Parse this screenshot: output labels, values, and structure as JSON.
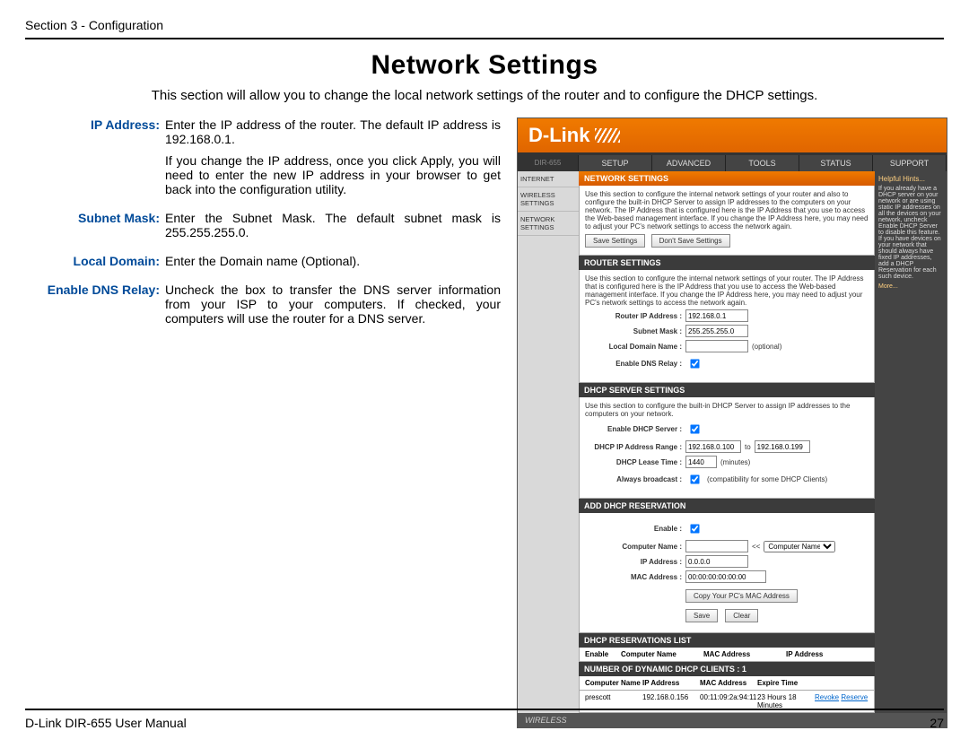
{
  "header": {
    "text": "Section 3 - Configuration"
  },
  "title": "Network Settings",
  "intro": "This section will allow you to change the local network settings of the router and to configure the DHCP settings.",
  "defs": {
    "ip_addr": {
      "term": "IP Address:",
      "p1": "Enter the IP address of the router. The default IP address is 192.168.0.1.",
      "p2": "If you change the IP address, once you click Apply, you will need to enter the new IP address in your browser to get back into the configuration utility."
    },
    "subnet": {
      "term": "Subnet Mask:",
      "p1": "Enter the Subnet Mask. The default subnet mask is 255.255.255.0."
    },
    "domain": {
      "term": "Local Domain:",
      "p1": "Enter the Domain name (Optional)."
    },
    "dnsrelay": {
      "term": "Enable DNS Relay:",
      "p1": "Uncheck the box to transfer the DNS server information from your ISP to your computers. If checked, your computers will use the router for a DNS server."
    }
  },
  "screenshot": {
    "brand": "D-Link",
    "model": "DIR-655",
    "tabs": [
      "SETUP",
      "ADVANCED",
      "TOOLS",
      "STATUS",
      "SUPPORT"
    ],
    "sidebar": [
      "INTERNET",
      "WIRELESS SETTINGS",
      "NETWORK SETTINGS"
    ],
    "support": {
      "title": "Helpful Hints...",
      "body": "If you already have a DHCP server on your network or are using static IP addresses on all the devices on your network, uncheck Enable DHCP Server to disable this feature. If you have devices on your network that should always have fixed IP addresses, add a DHCP Reservation for each such device.",
      "more": "More..."
    },
    "net_panel": {
      "title": "NETWORK SETTINGS",
      "desc": "Use this section to configure the internal network settings of your router and also to configure the built-in DHCP Server to assign IP addresses to the computers on your network. The IP Address that is configured here is the IP Address that you use to access the Web-based management interface. If you change the IP Address here, you may need to adjust your PC's network settings to access the network again.",
      "save": "Save Settings",
      "dont": "Don't Save Settings"
    },
    "router": {
      "title": "ROUTER SETTINGS",
      "desc": "Use this section to configure the internal network settings of your router. The IP Address that is configured here is the IP Address that you use to access the Web-based management interface. If you change the IP Address here, you may need to adjust your PC's network settings to access the network again.",
      "ip_lbl": "Router IP Address :",
      "ip_val": "192.168.0.1",
      "mask_lbl": "Subnet Mask :",
      "mask_val": "255.255.255.0",
      "dom_lbl": "Local Domain Name :",
      "dom_hint": "(optional)",
      "dns_lbl": "Enable DNS Relay :"
    },
    "dhcp": {
      "title": "DHCP SERVER SETTINGS",
      "desc": "Use this section to configure the built-in DHCP Server to assign IP addresses to the computers on your network.",
      "en_lbl": "Enable DHCP Server :",
      "range_lbl": "DHCP IP Address Range :",
      "range_from": "192.168.0.100",
      "range_to_word": "to",
      "range_to": "192.168.0.199",
      "lease_lbl": "DHCP Lease Time :",
      "lease_val": "1440",
      "lease_unit": "(minutes)",
      "bcast_lbl": "Always broadcast :",
      "bcast_hint": "(compatibility for some DHCP Clients)"
    },
    "addres": {
      "title": "ADD DHCP RESERVATION",
      "en_lbl": "Enable :",
      "cn_lbl": "Computer Name :",
      "cn_sel": "Computer Name",
      "ip_lbl": "IP Address :",
      "ip_val": "0.0.0.0",
      "mac_lbl": "MAC Address :",
      "mac_val": "00:00:00:00:00:00",
      "copy": "Copy Your PC's MAC Address",
      "save": "Save",
      "clear": "Clear"
    },
    "reslist": {
      "title": "DHCP RESERVATIONS LIST",
      "h1": "Enable",
      "h2": "Computer Name",
      "h3": "MAC Address",
      "h4": "IP Address"
    },
    "dyn": {
      "title": "NUMBER OF DYNAMIC DHCP CLIENTS : 1",
      "h1": "Computer Name",
      "h2": "IP Address",
      "h3": "MAC Address",
      "h4": "Expire Time",
      "r_name": "prescott",
      "r_ip": "192.168.0.156",
      "r_mac": "00:11:09:2a:94:11",
      "r_exp": "23 Hours 18 Minutes",
      "revoke": "Revoke",
      "reserve": "Reserve"
    },
    "bottom": "WIRELESS"
  },
  "footer": {
    "left": "D-Link DIR-655 User Manual",
    "right": "27"
  }
}
